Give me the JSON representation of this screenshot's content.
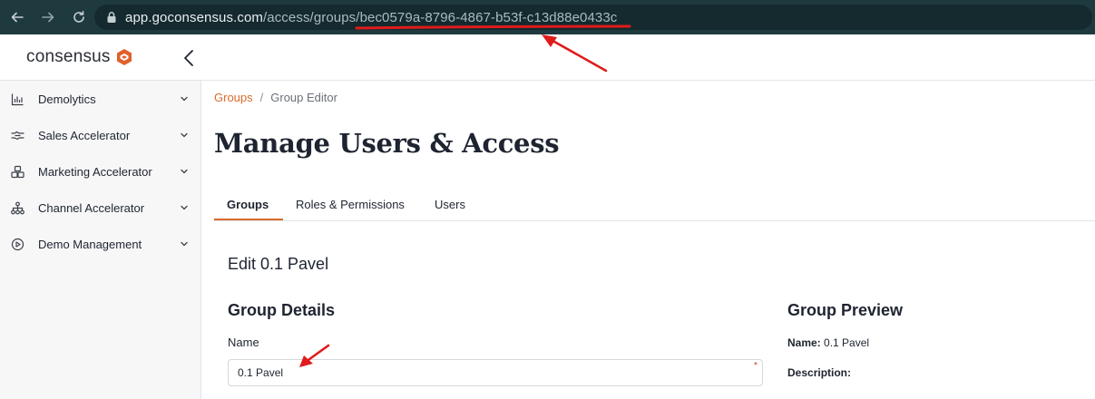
{
  "browser": {
    "url_host": "app.goconsensus.com",
    "url_path": "/access/groups/",
    "url_id": "bec0579a-8796-4867-b53f-c13d88e0433c"
  },
  "header": {
    "logo_text": "consensus"
  },
  "sidebar": {
    "items": [
      {
        "label": "Demolytics",
        "icon": "bar-chart-icon"
      },
      {
        "label": "Sales Accelerator",
        "icon": "handshake-icon"
      },
      {
        "label": "Marketing Accelerator",
        "icon": "boxes-icon"
      },
      {
        "label": "Channel Accelerator",
        "icon": "network-icon"
      },
      {
        "label": "Demo Management",
        "icon": "play-circle-icon"
      }
    ]
  },
  "breadcrumb": {
    "link": "Groups",
    "separator": "/",
    "current": "Group Editor"
  },
  "page": {
    "title": "Manage Users & Access"
  },
  "tabs": [
    {
      "label": "Groups",
      "active": true
    },
    {
      "label": "Roles & Permissions",
      "active": false
    },
    {
      "label": "Users",
      "active": false
    }
  ],
  "editor": {
    "edit_title": "Edit 0.1 Pavel",
    "details_title": "Group Details",
    "name_label": "Name",
    "name_value": "0.1 Pavel",
    "required_mark": "*"
  },
  "preview": {
    "title": "Group Preview",
    "name_key": "Name:",
    "name_value": "0.1 Pavel",
    "description_key": "Description:"
  },
  "colors": {
    "accent": "#d96b2b",
    "browser_bar": "#1f3a3f",
    "annotation": "#e01b1b"
  }
}
